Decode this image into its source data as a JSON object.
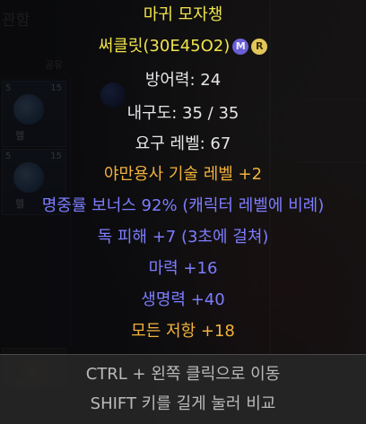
{
  "colors": {
    "white": "#e6e6e6",
    "set_green": "#f0e44a",
    "magic_blue": "#7d7dff",
    "skill_orange": "#f2b23c",
    "unique_gold": "#c9b27a",
    "footer_text": "#b9b9b9"
  },
  "background": {
    "inventory_title": "관함",
    "inventory_tab": "공유",
    "slots": [
      {
        "left_num": "5",
        "right_num": "15",
        "label": "헬"
      },
      {
        "left_num": "5",
        "right_num": "15",
        "label": "헬"
      }
    ],
    "bottom_label": "팔"
  },
  "tooltip": {
    "title": "마귀 모자챙",
    "name": "써클릿(30E45O2)",
    "badge_m": "M",
    "badge_r": "R",
    "defense": "방어력: 24",
    "durability": "내구도: 35 / 35",
    "required_level": "요구 레벨: 67",
    "skill_bonus": "야만용사 기술 레벨 +2",
    "accuracy_bonus": "명중률 보너스 92% (캐릭터 레벨에 비례)",
    "poison_damage": "독 피해 +7 (3초에 걸쳐)",
    "mana": "마력 +16",
    "life": "생명력 +40",
    "all_resist": "모든 저항 +18"
  },
  "footer": {
    "move_hint": "CTRL + 왼쪽 클릭으로 이동",
    "compare_hint": "SHIFT 키를 길게 눌러 비교"
  }
}
